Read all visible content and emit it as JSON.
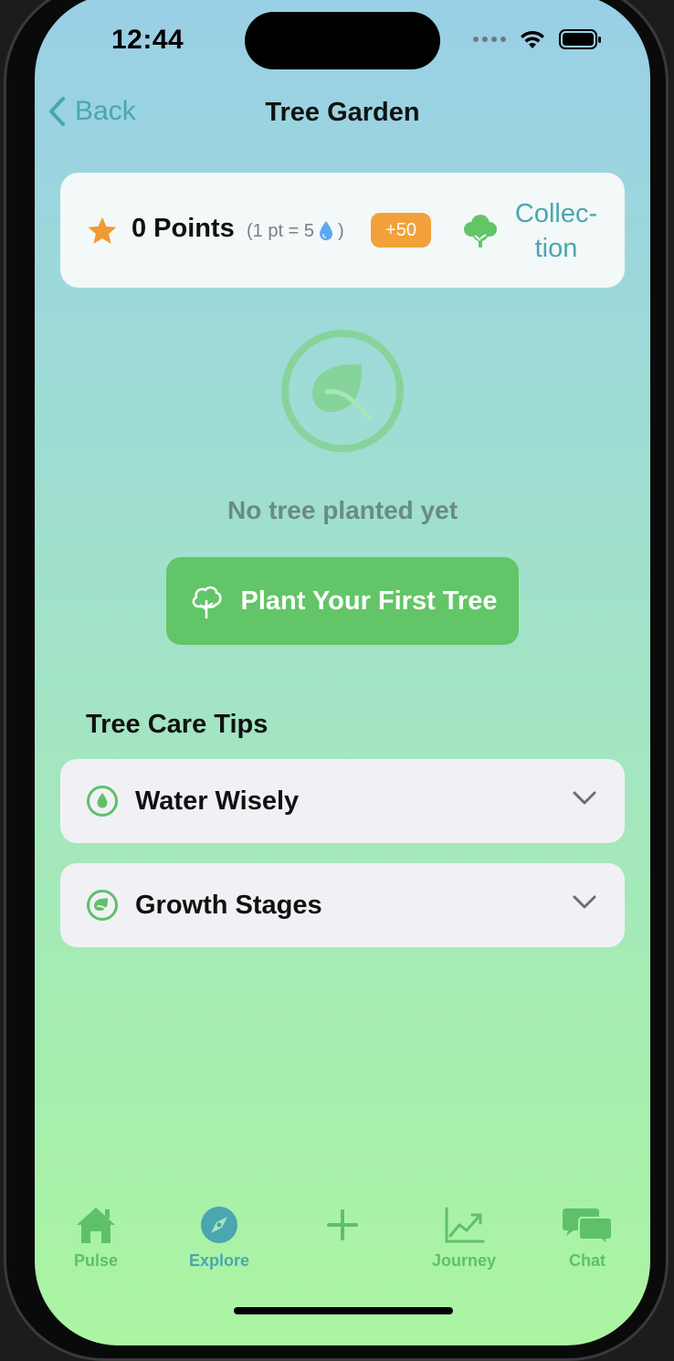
{
  "status": {
    "time": "12:44"
  },
  "nav": {
    "back_label": "Back",
    "title": "Tree Garden"
  },
  "points_card": {
    "points_label": "0 Points",
    "rate_prefix": "(1 pt = 5",
    "rate_suffix": ")",
    "bonus_label": "+50",
    "collection_line1": "Collec-",
    "collection_line2": "tion"
  },
  "empty_state": {
    "message": "No tree planted yet",
    "button_label": "Plant Your First Tree"
  },
  "tips": {
    "title": "Tree Care Tips",
    "items": [
      {
        "label": "Water Wisely",
        "icon": "water-drop-icon"
      },
      {
        "label": "Growth Stages",
        "icon": "leaf-icon"
      }
    ]
  },
  "tabbar": {
    "items": [
      {
        "label": "Pulse",
        "icon": "house-icon"
      },
      {
        "label": "Explore",
        "icon": "compass-icon",
        "active": true
      },
      {
        "label": "",
        "icon": "plus-icon"
      },
      {
        "label": "Journey",
        "icon": "chart-icon"
      },
      {
        "label": "Chat",
        "icon": "chat-bubbles-icon"
      }
    ]
  },
  "colors": {
    "accent_green": "#62c567",
    "accent_teal": "#4aa6b0",
    "bonus_orange": "#f2a13a"
  }
}
